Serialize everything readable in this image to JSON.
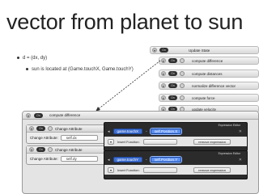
{
  "title": "vector from planet to sun",
  "bullets": [
    "d = (dx, dy)",
    "sun is located at (Game.touchX, Game.touchY)"
  ],
  "behaviors": {
    "toggle_label": "On",
    "items": [
      {
        "label": "Update State"
      },
      {
        "label": "compute difference"
      },
      {
        "label": "compute distances"
      },
      {
        "label": "normalize difference vector"
      },
      {
        "label": "compute force"
      },
      {
        "label": "update velocity"
      }
    ]
  },
  "panel": {
    "title": "compute difference",
    "toggle_label": "On",
    "change_attribute": [
      {
        "header": "Change Attribute",
        "field_label": "Change Attribute:",
        "value": "self.dx",
        "to_label": "To:"
      },
      {
        "header": "Change Attribute",
        "field_label": "Change Attribute:",
        "value": "self.dy",
        "to_label": "To:"
      }
    ],
    "editors": [
      {
        "title": "Expression Editor",
        "left": "game.touchX",
        "op": "-",
        "right": "self.Position.X",
        "insert": "Insert Function:",
        "remove": "remove expression"
      },
      {
        "title": "Expression Editor",
        "left": "game.touchY",
        "op": "-",
        "right": "self.Position.Y",
        "insert": "Insert Function:",
        "remove": "remove expression"
      }
    ]
  }
}
